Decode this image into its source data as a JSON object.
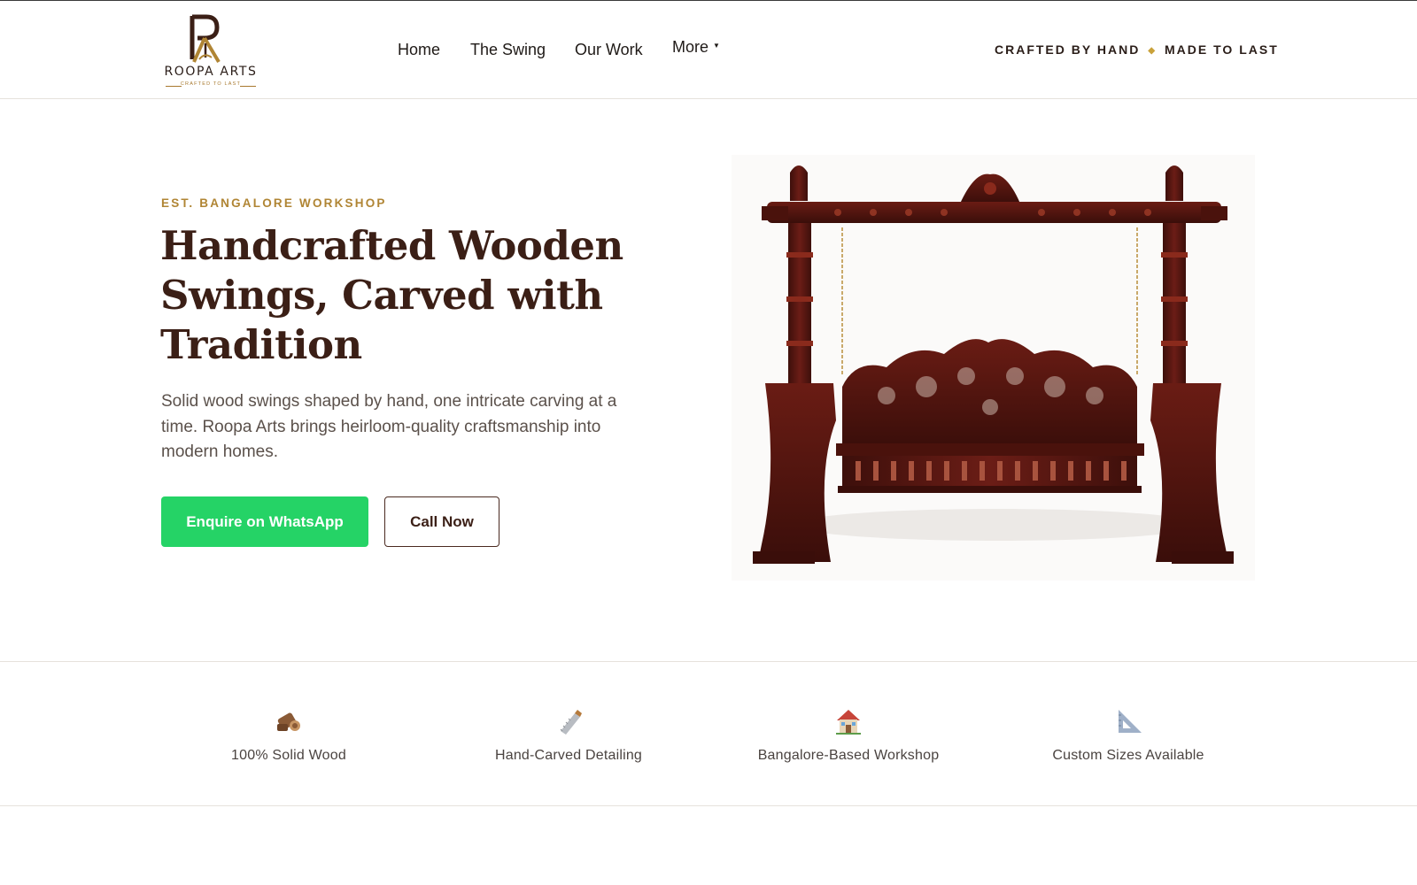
{
  "brand": {
    "name": "ROOPA ARTS",
    "tagline_small": "CRAFTED TO LAST",
    "accent": "#b08534",
    "dark": "#3b1f16"
  },
  "nav": {
    "items": [
      {
        "label": "Home"
      },
      {
        "label": "The Swing"
      },
      {
        "label": "Our Work"
      },
      {
        "label": "More"
      }
    ]
  },
  "header_tagline": {
    "left": "CRAFTED BY HAND",
    "separator": "◆",
    "right": "MADE TO LAST"
  },
  "hero": {
    "eyebrow": "EST. BANGALORE WORKSHOP",
    "title": "Handcrafted Wooden Swings, Carved with Tradition",
    "subtitle": "Solid wood swings shaped by hand, one intricate carving at a time. Roopa Arts brings heirloom-quality craftsmanship into modern homes.",
    "primary_button": "Enquire on WhatsApp",
    "primary_color": "#25d366",
    "secondary_button": "Call Now"
  },
  "features": [
    {
      "icon": "wood-log-icon",
      "label": "100% Solid Wood"
    },
    {
      "icon": "saw-icon",
      "label": "Hand-Carved Detailing"
    },
    {
      "icon": "house-icon",
      "label": "Bangalore-Based Workshop"
    },
    {
      "icon": "set-square-icon",
      "label": "Custom Sizes Available"
    }
  ]
}
